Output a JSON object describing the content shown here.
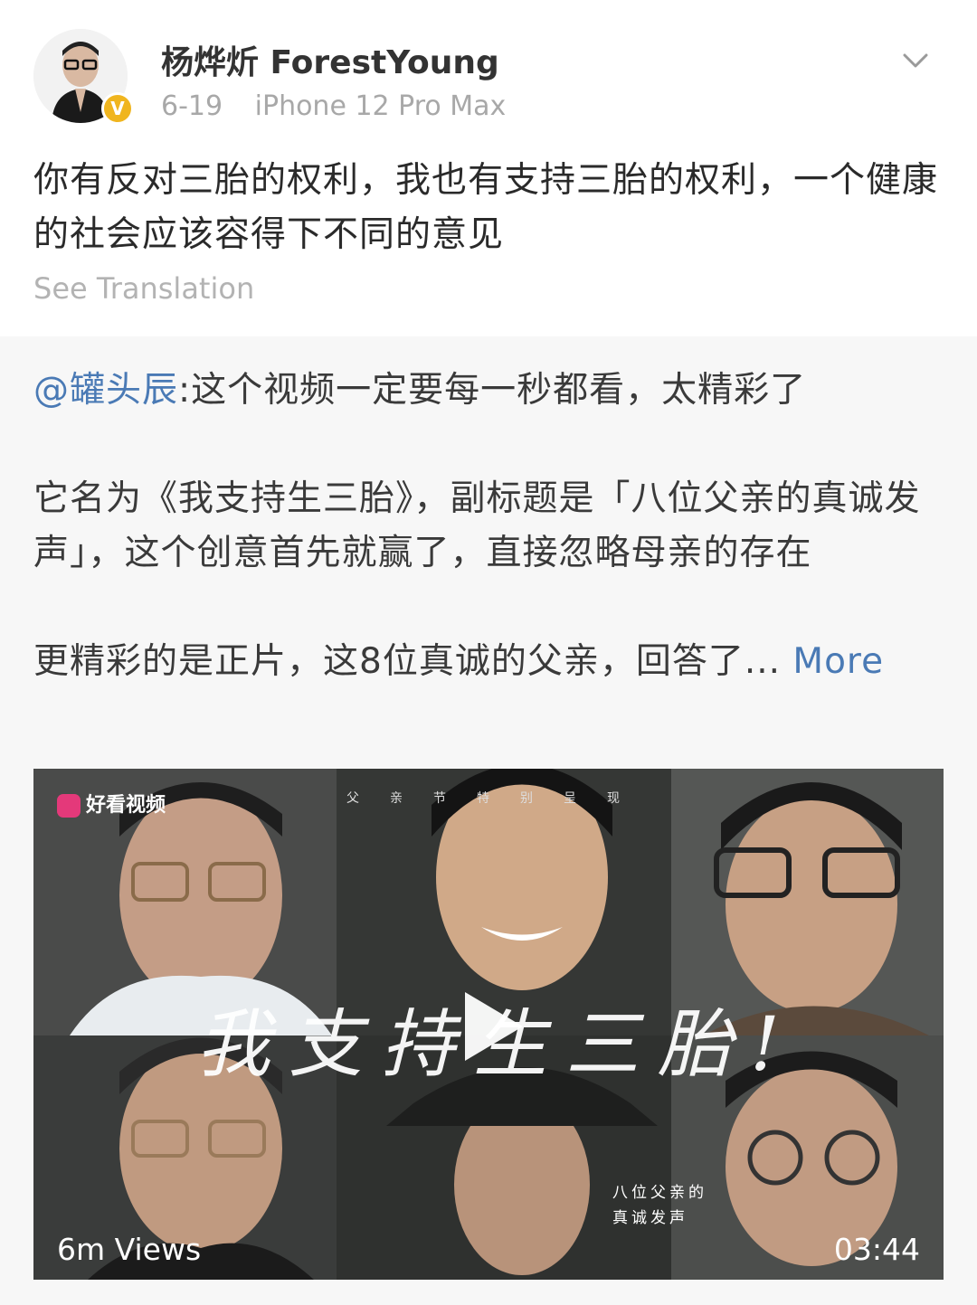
{
  "post": {
    "username": "杨烨炘 ForestYoung",
    "date": "6-19",
    "device": "iPhone 12 Pro Max",
    "verified_badge": "V",
    "text": "你有反对三胎的权利，我也有支持三胎的权利，一个健康的社会应该容得下不同的意见",
    "see_translation": "See Translation"
  },
  "repost": {
    "mention": "@罐头辰",
    "line1": ":这个视频一定要每一秒都看，太精彩了",
    "para2": "它名为《我支持生三胎》，副标题是「八位父亲的真诚发声」，这个创意首先就赢了，直接忽略母亲的存在",
    "para3": "更精彩的是正片，这8位真诚的父亲，回答了...",
    "more": "More"
  },
  "video": {
    "source": "好看视频",
    "top_caption": "父亲节特别呈现",
    "title_overlay": "我支持生三胎!",
    "side_caption_1": "八位父亲的",
    "side_caption_2": "真诚发声",
    "views": "6m Views",
    "duration": "03:44"
  },
  "colors": {
    "link": "#4a7ab5",
    "verified": "#f0b51e",
    "repost_bg": "#f7f7f7"
  }
}
